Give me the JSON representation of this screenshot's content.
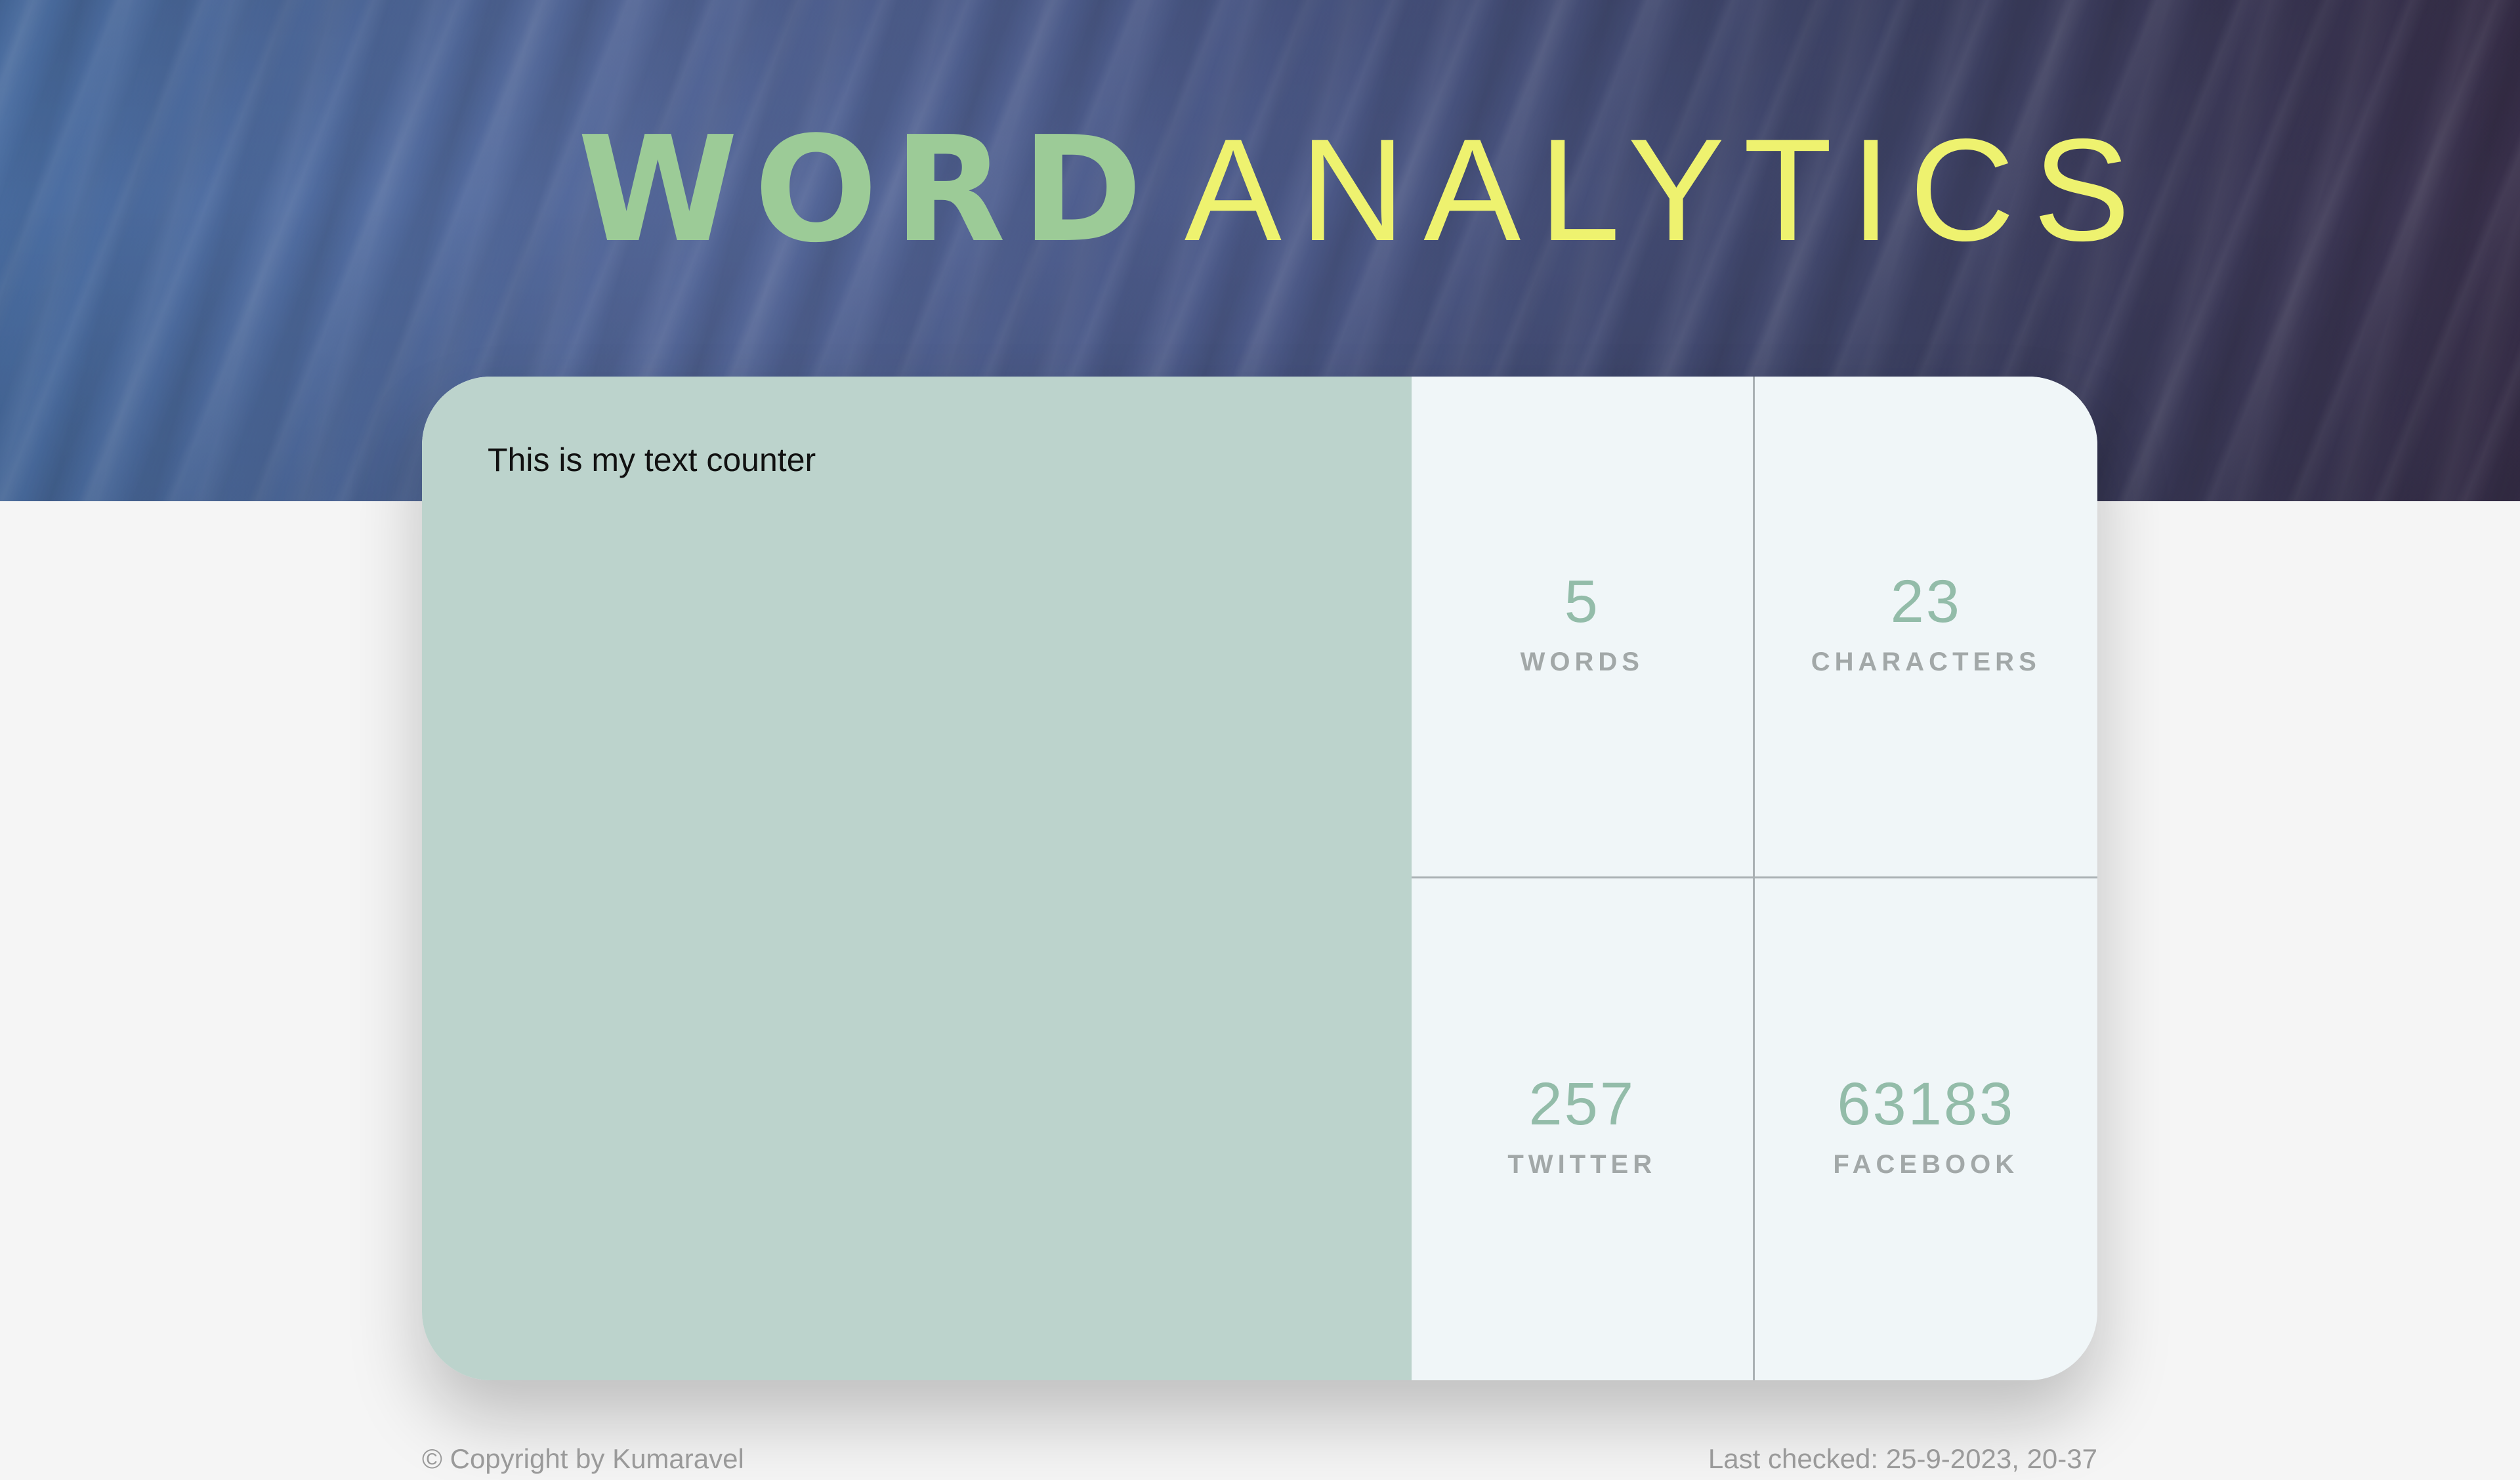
{
  "header": {
    "title_bold": "WORD",
    "title_light": "ANALYTICS"
  },
  "editor": {
    "value": "This is my text counter"
  },
  "stats": [
    {
      "value": "5",
      "label": "WORDS"
    },
    {
      "value": "23",
      "label": "CHARACTERS"
    },
    {
      "value": "257",
      "label": "TWITTER"
    },
    {
      "value": "63183",
      "label": "FACEBOOK"
    }
  ],
  "footer": {
    "copyright": "© Copyright by Kumaravel",
    "last_checked": "Last checked: 25-9-2023, 20-37"
  },
  "colors": {
    "title_bold": "#9ccb97",
    "title_light": "#eef26f",
    "textarea_bg": "#bcd3cc",
    "stat_number": "#93bca9",
    "stat_label": "#a2a8a8",
    "stats_bg": "#f0f6f8"
  }
}
